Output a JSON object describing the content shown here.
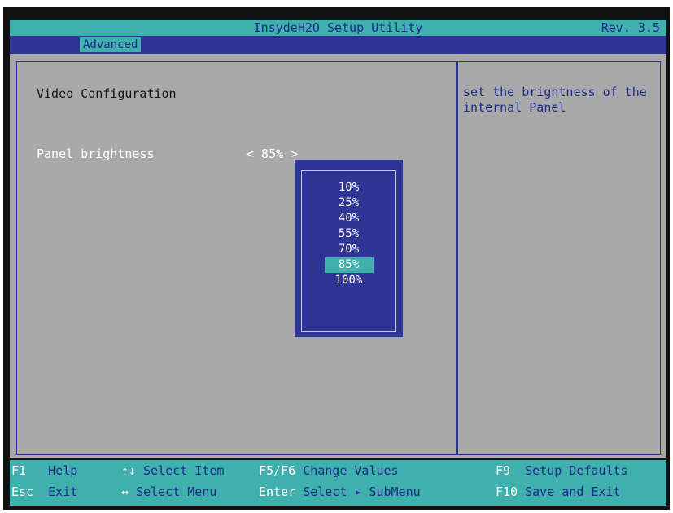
{
  "header": {
    "title": "InsydeH2O Setup Utility",
    "revision": "Rev. 3.5"
  },
  "tabs": [
    {
      "label": "Advanced",
      "active": true
    }
  ],
  "main": {
    "section_title": "Video Configuration",
    "setting": {
      "label": "Panel brightness",
      "value": "<  85% >"
    }
  },
  "help": {
    "text": "set the brightness of the internal Panel"
  },
  "dropdown": {
    "options": [
      "10%",
      "25%",
      "40%",
      "55%",
      "70%",
      "85%",
      "100%"
    ],
    "selected": "85%"
  },
  "footer": {
    "items": [
      {
        "key": "F1",
        "desc": "Help"
      },
      {
        "key": "↑↓",
        "desc": "Select Item"
      },
      {
        "key": "F5/F6",
        "desc": "Change Values"
      },
      {
        "key": "F9",
        "desc": "Setup Defaults"
      },
      {
        "key": "Esc",
        "desc": "Exit"
      },
      {
        "key": "↔",
        "desc": "Select Menu"
      },
      {
        "key": "Enter",
        "desc": "Select ▸ SubMenu"
      },
      {
        "key": "F10",
        "desc": "Save and Exit"
      }
    ]
  },
  "colors": {
    "teal": "#3fb0ac",
    "blue": "#2f3594",
    "gray": "#a9a9a9",
    "text_blue": "#1c2a8c"
  }
}
